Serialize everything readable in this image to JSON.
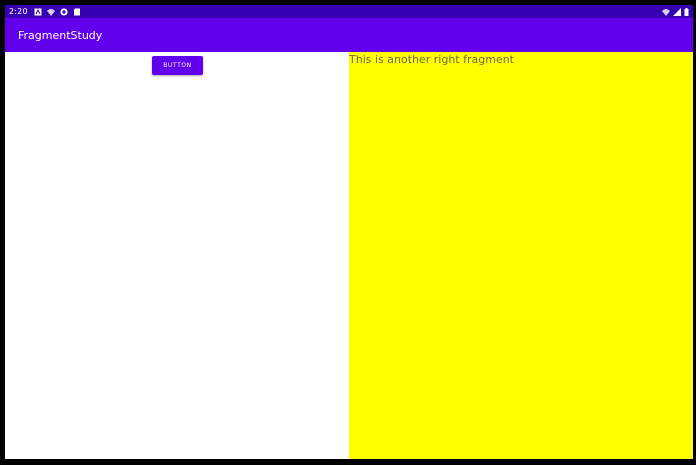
{
  "status_bar": {
    "time": "2:20",
    "left_icons": [
      "a-icon",
      "wifi-icon",
      "circle-notification-icon",
      "sd-card-icon"
    ],
    "right_icons": [
      "wifi-icon",
      "signal-icon",
      "battery-icon"
    ]
  },
  "app_bar": {
    "title": "FragmentStudy"
  },
  "left_fragment": {
    "button_label": "BUTTON"
  },
  "right_fragment": {
    "text": "This is another right fragment",
    "background_color": "#ffff00"
  },
  "colors": {
    "primary": "#6200ee",
    "primary_dark": "#3700b3"
  }
}
